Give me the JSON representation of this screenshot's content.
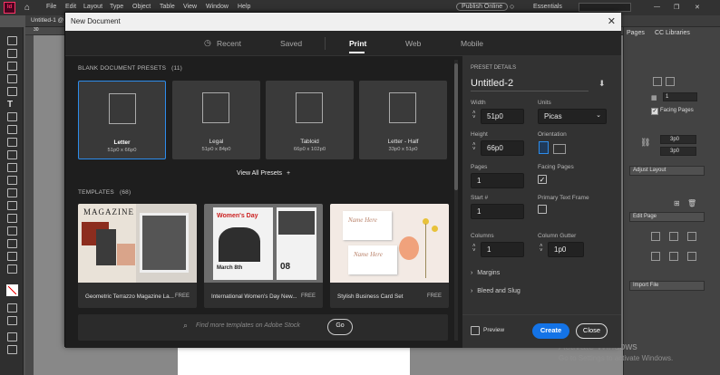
{
  "menubar": {
    "items": [
      "File",
      "Edit",
      "Layout",
      "Type",
      "Object",
      "Table",
      "View",
      "Window",
      "Help"
    ],
    "publish_label": "Publish Online",
    "workspace_label": "Essentials"
  },
  "doc_tab": {
    "label": "Untitled-1 @"
  },
  "ruler": {
    "mark": "30"
  },
  "right_panel": {
    "tabs": [
      "Pages",
      "CC Libraries"
    ],
    "facing_pages_label": "Facing Pages",
    "field_value": "1",
    "spin1": "3p0",
    "spin2": "3p0",
    "adjust_layout_label": "Adjust Layout",
    "edit_page_label": "Edit Page",
    "import_file_label": "Import File"
  },
  "dialog": {
    "title": "New Document",
    "tabs": [
      {
        "label": "Recent",
        "icon": "clock-icon"
      },
      {
        "label": "Saved"
      },
      {
        "label": "Print"
      },
      {
        "label": "Web"
      },
      {
        "label": "Mobile"
      }
    ],
    "active_tab": "Print",
    "presets_header": "BLANK DOCUMENT PRESETS",
    "presets_count": "(11)",
    "presets": [
      {
        "name": "Letter",
        "size": "51p0 x 66p0"
      },
      {
        "name": "Legal",
        "size": "51p0 x 84p0"
      },
      {
        "name": "Tabloid",
        "size": "66p0 x 102p0"
      },
      {
        "name": "Letter - Half",
        "size": "33p0 x 51p0"
      }
    ],
    "view_all_label": "View All Presets",
    "view_all_icon": "+",
    "templates_header": "TEMPLATES",
    "templates_count": "(68)",
    "templates": [
      {
        "name": "Geometric Terrazzo Magazine La...",
        "price": "FREE",
        "thumb_text": "MAGAZINE"
      },
      {
        "name": "International Women's Day New...",
        "price": "FREE",
        "thumb_text": "Women's Day",
        "thumb_sub": "March 8th",
        "thumb_num": "08"
      },
      {
        "name": "Stylish Business Card Set",
        "price": "FREE",
        "thumb_text": "Name Here"
      }
    ],
    "search_placeholder": "Find more templates on Adobe Stock",
    "go_label": "Go",
    "details": {
      "header": "PRESET DETAILS",
      "doc_name": "Untitled-2",
      "width_label": "Width",
      "width_value": "51p0",
      "units_label": "Units",
      "units_value": "Picas",
      "height_label": "Height",
      "height_value": "66p0",
      "orientation_label": "Orientation",
      "pages_label": "Pages",
      "pages_value": "1",
      "facing_label": "Facing Pages",
      "facing_checked": true,
      "start_label": "Start #",
      "start_value": "1",
      "primary_frame_label": "Primary Text Frame",
      "primary_frame_checked": false,
      "columns_label": "Columns",
      "columns_value": "1",
      "gutter_label": "Column Gutter",
      "gutter_value": "1p0",
      "margins_label": "Margins",
      "bleed_label": "Bleed and Slug",
      "preview_label": "Preview",
      "create_label": "Create",
      "close_label": "Close"
    }
  },
  "watermark": {
    "line1": "Activate Windows",
    "line2": "Go to Settings to activate Windows."
  },
  "colors": {
    "accent": "#1473e6",
    "select_border": "#2d8ceb",
    "dialog_bg": "#1e1e1e"
  }
}
